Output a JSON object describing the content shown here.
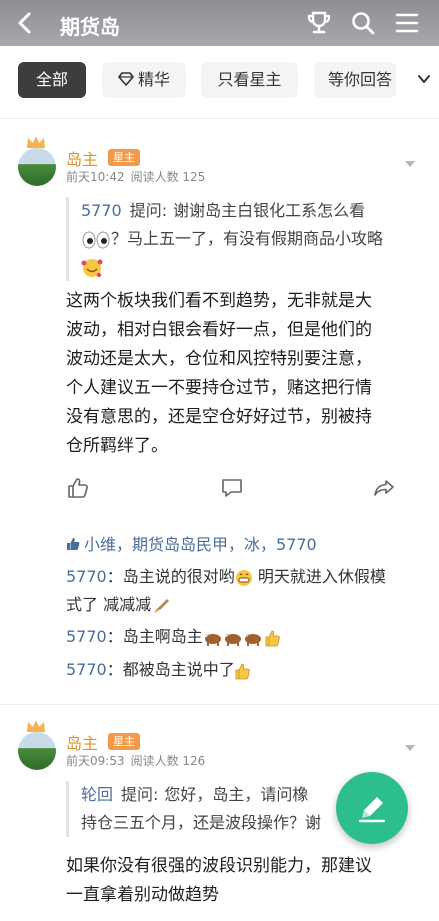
{
  "header": {
    "title": "期货岛",
    "back_icon": "chevron-left-icon",
    "trophy_icon": "trophy-icon",
    "search_icon": "search-icon",
    "menu_icon": "menu-icon"
  },
  "tabs": [
    {
      "label": "全部",
      "active": true
    },
    {
      "label": "精华",
      "icon": "diamond-icon",
      "active": false
    },
    {
      "label": "只看星主",
      "active": false
    },
    {
      "label": "等你回答",
      "active": false
    }
  ],
  "posts": [
    {
      "author": "岛主",
      "badge": "星主",
      "time": "前天10:42",
      "reads": "阅读人数 125",
      "question_user": "5770",
      "question_label": "提问:",
      "question_text_1": "谢谢岛主白银化工系怎么看",
      "question_text_2": "？马上五一了，有没有假期商品小攻略",
      "body": [
        "这两个板块我们看不到趋势，无非就是大",
        "波动，相对白银会看好一点，但是他们的",
        "波动还是太大，仓位和风控特别要注意，",
        "个人建议五一不要持仓过节，赌这把行情",
        "没有意思的，还是空仓好好过节，别被持",
        "仓所羁绊了。"
      ],
      "likes": "小维，期货岛岛民甲，冰，5770",
      "comments": [
        {
          "user": "5770",
          "text_1": "岛主说的很对哟",
          "text_2": " 明天就进入休假模",
          "text_3": "式了 减减减"
        },
        {
          "user": "5770",
          "text": "岛主啊岛主"
        },
        {
          "user": "5770",
          "text": "都被岛主说中了"
        }
      ]
    },
    {
      "author": "岛主",
      "badge": "星主",
      "time": "前天09:53",
      "reads": "阅读人数 126",
      "question_user": "轮回",
      "question_label": "提问:",
      "question_text_1": "您好，岛主，请问橡",
      "question_text_2": "持仓三五个月，还是波段操作？谢",
      "body": [
        "如果你没有很强的波段识别能力，那建议",
        "一直拿着别动做趋势"
      ]
    }
  ],
  "colors": {
    "accent_green": "#2cbf8c",
    "author_orange": "#e0922a",
    "link_blue": "#4a6f96"
  },
  "fab_icon": "pencil-icon"
}
